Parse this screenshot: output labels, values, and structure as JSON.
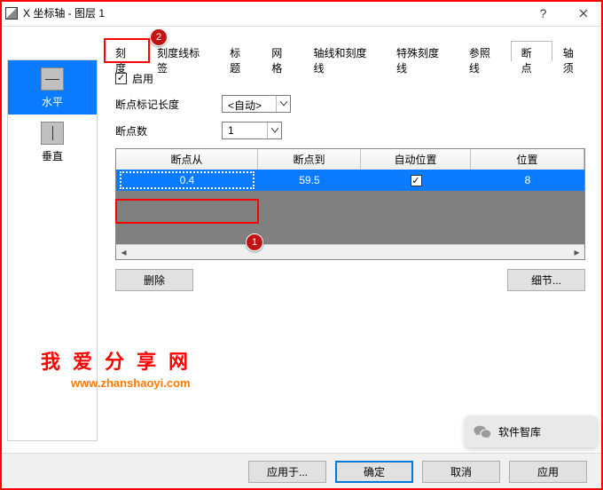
{
  "window": {
    "title": "X 坐标轴 - 图层 1",
    "help": "?",
    "close_label": "Close"
  },
  "sidebar": {
    "items": [
      {
        "label": "水平",
        "selected": true
      },
      {
        "label": "垂直",
        "selected": false
      }
    ]
  },
  "tabs": [
    {
      "label": "刻度"
    },
    {
      "label": "刻度线标签"
    },
    {
      "label": "标题"
    },
    {
      "label": "网格"
    },
    {
      "label": "轴线和刻度线"
    },
    {
      "label": "特殊刻度线"
    },
    {
      "label": "参照线"
    },
    {
      "label": "断点",
      "active": true
    },
    {
      "label": "轴须"
    }
  ],
  "panel": {
    "enable_label": "启用",
    "enable_checked": true,
    "mark_len_label": "断点标记长度",
    "mark_len_value": "<自动>",
    "count_label": "断点数",
    "count_value": "1"
  },
  "table": {
    "headers": [
      "断点从",
      "断点到",
      "自动位置",
      "位置"
    ],
    "row": {
      "from": "0.4",
      "to": "59.5",
      "auto": true,
      "pos": "8"
    }
  },
  "actions": {
    "delete": "删除",
    "details": "细节..."
  },
  "buttons": {
    "apply_to": "应用于...",
    "ok": "确定",
    "cancel": "取消",
    "apply": "应用"
  },
  "watermark": {
    "text": "我爱分享网",
    "url": "www.zhanshaoyi.com"
  },
  "badges": {
    "b1": "1",
    "b2": "2"
  },
  "tip": {
    "text": "软件智库"
  }
}
